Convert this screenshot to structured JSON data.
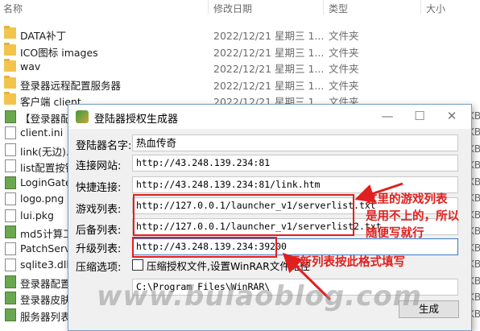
{
  "explorer": {
    "columns": {
      "name": "名称",
      "date": "修改日期",
      "type": "类型",
      "size": "大小"
    },
    "rows": [
      {
        "icon": "folder-icon",
        "name": "DATA补丁",
        "date": "2022/12/21 星期三 1...",
        "type": "文件夹",
        "size": ""
      },
      {
        "icon": "folder-icon",
        "name": "ICO图标 images",
        "date": "2022/12/21 星期三 1...",
        "type": "文件夹",
        "size": ""
      },
      {
        "icon": "folder-icon",
        "name": "wav",
        "date": "2022/12/21 星期三 1...",
        "type": "文件夹",
        "size": ""
      },
      {
        "icon": "folder-icon",
        "name": "登录器远程配置服务器",
        "date": "2022/12/21 星期三 1...",
        "type": "文件夹",
        "size": ""
      },
      {
        "icon": "folder-icon",
        "name": "客户端 client",
        "date": "2022/12/21 星期三 1...",
        "type": "文件夹",
        "size": ""
      },
      {
        "icon": "exe-icon",
        "name": "【登录器配",
        "date": "",
        "type": "",
        "size": "KB"
      },
      {
        "icon": "file-icon",
        "name": "client.ini",
        "date": "",
        "type": "",
        "size": "KB"
      },
      {
        "icon": "file-icon",
        "name": "link(无边).h",
        "date": "",
        "type": "",
        "size": "KB"
      },
      {
        "icon": "file-icon",
        "name": "list配置按钮",
        "date": "",
        "type": "",
        "size": "KB"
      },
      {
        "icon": "exe-icon",
        "name": "LoginGate",
        "date": "",
        "type": "",
        "size": "KB"
      },
      {
        "icon": "file-icon",
        "name": "logo.png",
        "date": "",
        "type": "",
        "size": "KB"
      },
      {
        "icon": "file-icon",
        "name": "lui.pkg",
        "date": "",
        "type": "",
        "size": "KB"
      },
      {
        "icon": "exe-icon",
        "name": "md5计算工",
        "date": "",
        "type": "",
        "size": "KB"
      },
      {
        "icon": "file-icon",
        "name": "PatchServe",
        "date": "",
        "type": "",
        "size": "KB"
      },
      {
        "icon": "file-icon",
        "name": "sqlite3.dll",
        "date": "",
        "type": "",
        "size": "KB"
      },
      {
        "icon": "exe-icon",
        "name": "登录器配置",
        "date": "",
        "type": "",
        "size": "KB"
      },
      {
        "icon": "exe-icon",
        "name": "登录器皮肤",
        "date": "",
        "type": "",
        "size": "KB"
      },
      {
        "icon": "exe-icon",
        "name": "服务器列表",
        "date": "",
        "type": "",
        "size": "KB"
      }
    ]
  },
  "dialog": {
    "title": "登陆器授权生成器",
    "minimize": "—",
    "maximize": "☐",
    "close": "✕",
    "fields": {
      "name_label": "登陆器名字:",
      "name_value": "热血传奇",
      "site_label": "连接网站:",
      "site_value": "http://43.248.139.234:81",
      "quick_label": "快捷连接:",
      "quick_value": "http://43.248.139.234:81/link.htm",
      "gamelist_label": "游戏列表:",
      "gamelist_value": "http://127.0.0.1/launcher_v1/serverlist.txt",
      "backup_label": "后备列表:",
      "backup_value": "http://127.0.0.1/launcher_v1/serverlist2.txt",
      "upgrade_label": "升级列表:",
      "upgrade_value": "http://43.248.139.234:39200",
      "compress_label": "压缩选项:",
      "compress_check_label": "压缩授权文件,设置WinRAR文件路径",
      "compress_path": "C:\\Program Files\\WinRAR\\"
    },
    "generate_button": "生成"
  },
  "annotations": {
    "note1_line1": "这里的游戏列表",
    "note1_line2": "是用不上的，所以",
    "note1_line3": "随便写就行",
    "note2": "更新列表按此格式填写",
    "accent": "#e0201f"
  },
  "watermark": {
    "text": "www.bulaoblog.com"
  }
}
